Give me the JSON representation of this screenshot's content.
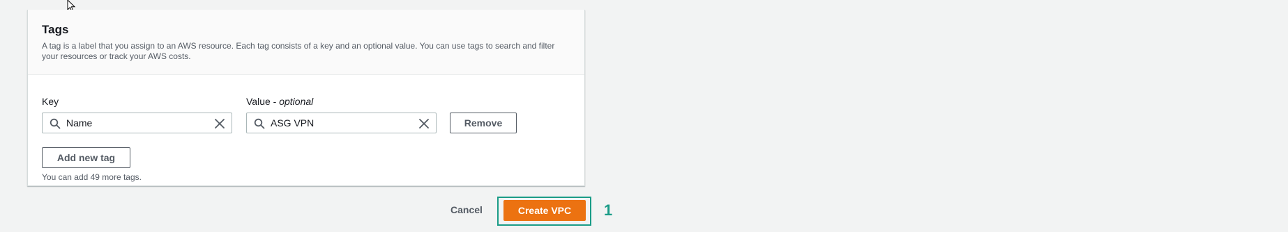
{
  "tags_section": {
    "title": "Tags",
    "description": "A tag is a label that you assign to an AWS resource. Each tag consists of a key and an optional value. You can use tags to search and filter your resources or track your AWS costs.",
    "key_label": "Key",
    "value_label": "Value -",
    "value_label_optional": "optional",
    "tags": [
      {
        "key": "Name",
        "value": "ASG VPN"
      }
    ],
    "remove_label": "Remove",
    "add_tag_label": "Add new tag",
    "remaining_hint": "You can add 49 more tags."
  },
  "footer": {
    "cancel_label": "Cancel",
    "create_label": "Create VPC",
    "step_number": "1"
  },
  "icons": {
    "search": "search-icon",
    "clear": "close-icon",
    "cursor": "mouse-pointer-icon"
  },
  "colors": {
    "primary_button": "#ec7211",
    "highlight": "#1a9c87",
    "background": "#f2f3f3"
  }
}
